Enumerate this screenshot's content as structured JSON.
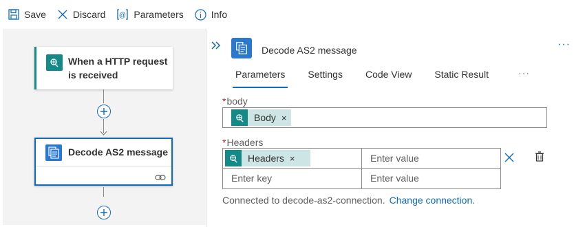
{
  "toolbar": {
    "save": "Save",
    "discard": "Discard",
    "parameters": "Parameters",
    "info": "Info"
  },
  "designer": {
    "trigger_title": "When a HTTP request is received",
    "action_title": "Decode AS2 message"
  },
  "panel": {
    "title": "Decode AS2 message",
    "more_glyph": "···",
    "tabs": [
      {
        "label": "Parameters",
        "active": true
      },
      {
        "label": "Settings"
      },
      {
        "label": "Code View"
      },
      {
        "label": "Static Result"
      }
    ],
    "tabs_more": "···",
    "body": {
      "label": "body",
      "required_mark": "*",
      "token": "Body",
      "token_remove": "×"
    },
    "headers": {
      "label": "Headers",
      "required_mark": "*",
      "token": "Headers",
      "token_remove": "×",
      "value_placeholder": "Enter value",
      "key_placeholder": "Enter key",
      "value_placeholder_2": "Enter value"
    },
    "connection": {
      "text": "Connected to decode-as2-connection.",
      "change_link": "Change connection."
    }
  },
  "colors": {
    "accent": "#0f6cbd",
    "http_trigger": "#138a88",
    "token_bg": "#cde6e5",
    "canvas_bg": "#f3f3f3"
  },
  "icons": [
    "save-icon",
    "discard-icon",
    "parameters-icon",
    "info-icon",
    "http-request-icon",
    "as2-icon",
    "link-icon",
    "collapse-icon",
    "add-icon",
    "delete-icon",
    "trash-icon"
  ]
}
